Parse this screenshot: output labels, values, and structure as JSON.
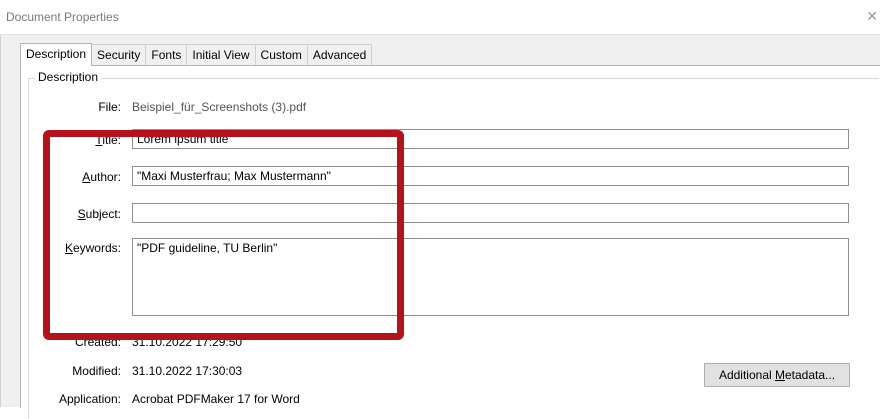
{
  "window": {
    "title": "Document Properties",
    "close_glyph": "✕"
  },
  "tabs": [
    {
      "label": "Description",
      "active": true
    },
    {
      "label": "Security",
      "active": false
    },
    {
      "label": "Fonts",
      "active": false
    },
    {
      "label": "Initial View",
      "active": false
    },
    {
      "label": "Custom",
      "active": false
    },
    {
      "label": "Advanced",
      "active": false
    }
  ],
  "description": {
    "group_title": "Description",
    "file": {
      "label": "File:",
      "value": "Beispiel_für_Screenshots (3).pdf"
    },
    "title": {
      "label_pre": "",
      "label_u": "T",
      "label_post": "itle:",
      "value": "Lorem ipsum title"
    },
    "author": {
      "label_pre": "",
      "label_u": "A",
      "label_post": "uthor:",
      "value": "\"Maxi Musterfrau; Max Mustermann\""
    },
    "subject": {
      "label_pre": "",
      "label_u": "S",
      "label_post": "ubject:",
      "value": ""
    },
    "keywords": {
      "label_pre": "",
      "label_u": "K",
      "label_post": "eywords:",
      "value": "\"PDF guideline, TU Berlin\""
    },
    "created": {
      "label": "Created:",
      "value": "31.10.2022 17:29:50"
    },
    "modified": {
      "label": "Modified:",
      "value": "31.10.2022 17:30:03"
    },
    "application": {
      "label": "Application:",
      "value": "Acrobat PDFMaker 17 for Word"
    },
    "metadata_button": {
      "label_pre": "Additional ",
      "label_u": "M",
      "label_post": "etadata..."
    }
  },
  "colors": {
    "highlight_box": "#b5121b"
  }
}
